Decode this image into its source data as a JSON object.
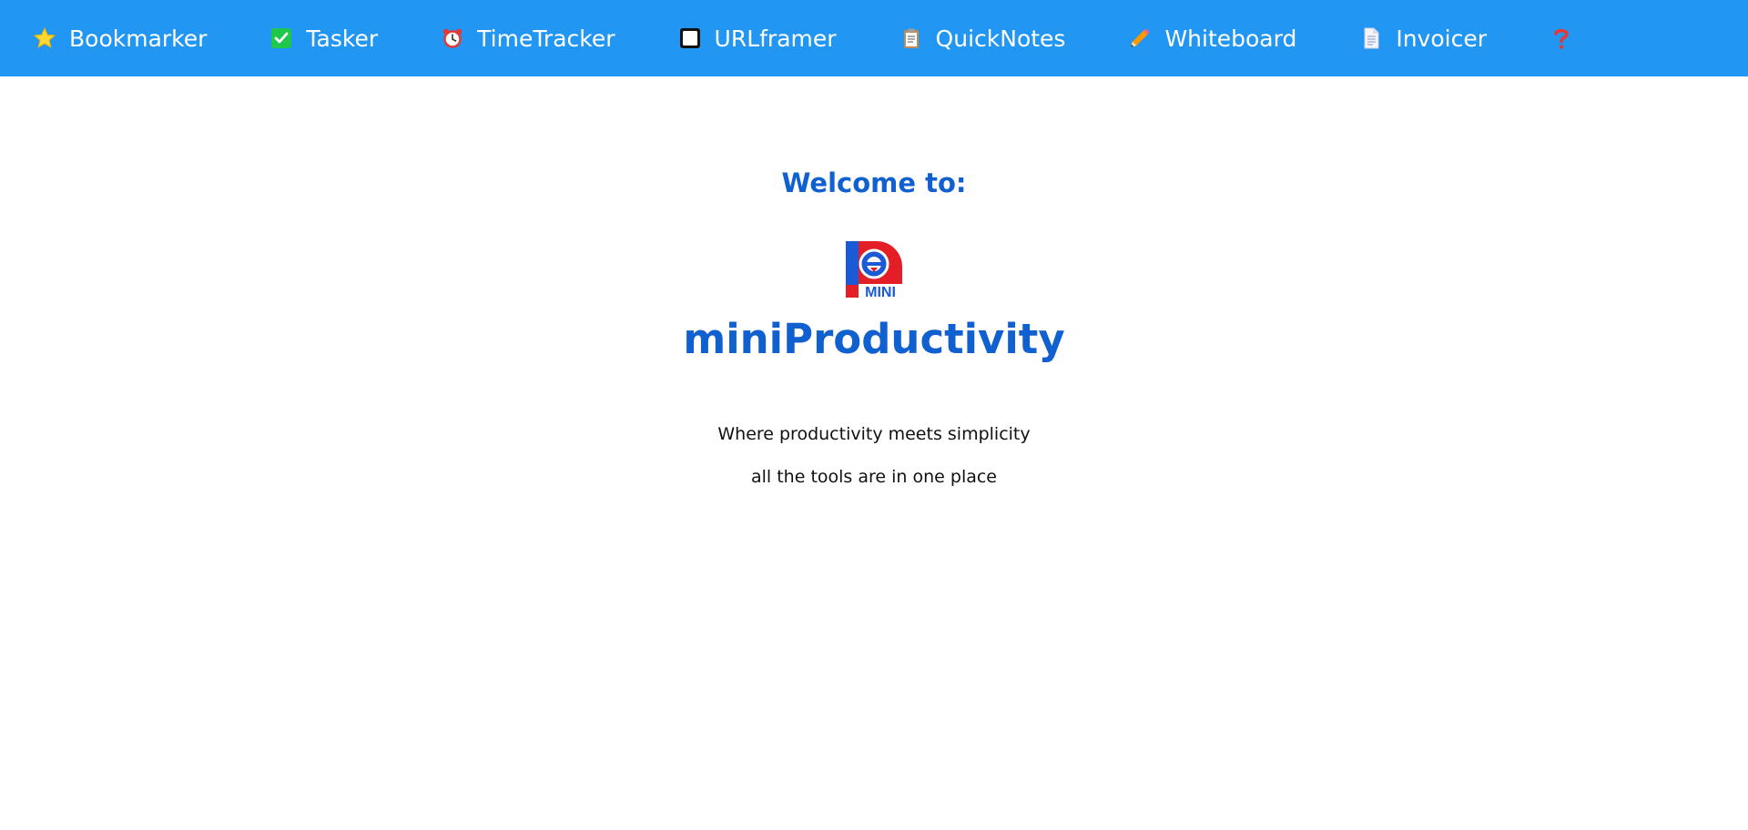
{
  "nav": {
    "items": [
      {
        "label": "Bookmarker",
        "icon": "star-icon"
      },
      {
        "label": "Tasker",
        "icon": "checkbox-checked-icon"
      },
      {
        "label": "TimeTracker",
        "icon": "alarm-clock-icon"
      },
      {
        "label": "URLframer",
        "icon": "frame-square-icon"
      },
      {
        "label": "QuickNotes",
        "icon": "clipboard-icon"
      },
      {
        "label": "Whiteboard",
        "icon": "pencil-icon"
      },
      {
        "label": "Invoicer",
        "icon": "document-icon"
      },
      {
        "label": "",
        "icon": "question-mark-icon"
      }
    ]
  },
  "main": {
    "welcome": "Welcome to:",
    "logo_text": "MINI",
    "app_name": "miniProductivity",
    "tagline_1": "Where productivity meets simplicity",
    "tagline_2": "all the tools are in one place"
  },
  "colors": {
    "topbar": "#2196f3",
    "heading": "#1060d0",
    "logo_red": "#e41e26",
    "logo_blue": "#1a5ad6"
  }
}
